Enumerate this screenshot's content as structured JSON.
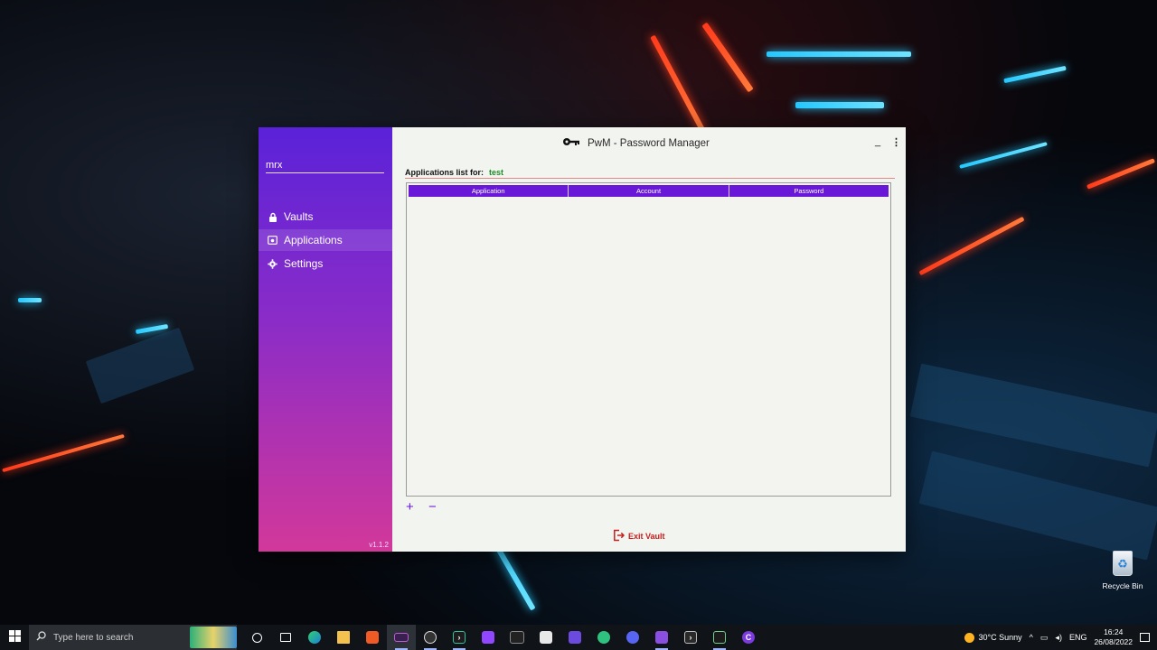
{
  "window": {
    "title": "PwM - Password Manager",
    "minimize_label": "_",
    "menu_label": "⋮"
  },
  "sidebar": {
    "username": "mrx",
    "items": [
      {
        "label": "Vaults",
        "icon": "lock-icon"
      },
      {
        "label": "Applications",
        "icon": "app-window-icon",
        "active": true
      },
      {
        "label": "Settings",
        "icon": "gear-icon"
      }
    ],
    "version": "v1.1.2"
  },
  "main": {
    "list_label": "Applications list for:",
    "vault_name": "test",
    "columns": [
      "Application",
      "Account",
      "Password"
    ],
    "rows": [],
    "add_label": "+",
    "remove_label": "−",
    "exit_label": "Exit Vault"
  },
  "desktop": {
    "recycle_bin_label": "Recycle Bin"
  },
  "taskbar": {
    "search_placeholder": "Type here to search",
    "weather": "30°C  Sunny",
    "language": "ENG",
    "time": "16:24",
    "date": "26/08/2022"
  },
  "colors": {
    "accent": "#6a18d8",
    "sidebar_top": "#5a22d8",
    "sidebar_bottom": "#d2389a",
    "exit": "#c42020",
    "vault_name": "#1e8a2a"
  }
}
